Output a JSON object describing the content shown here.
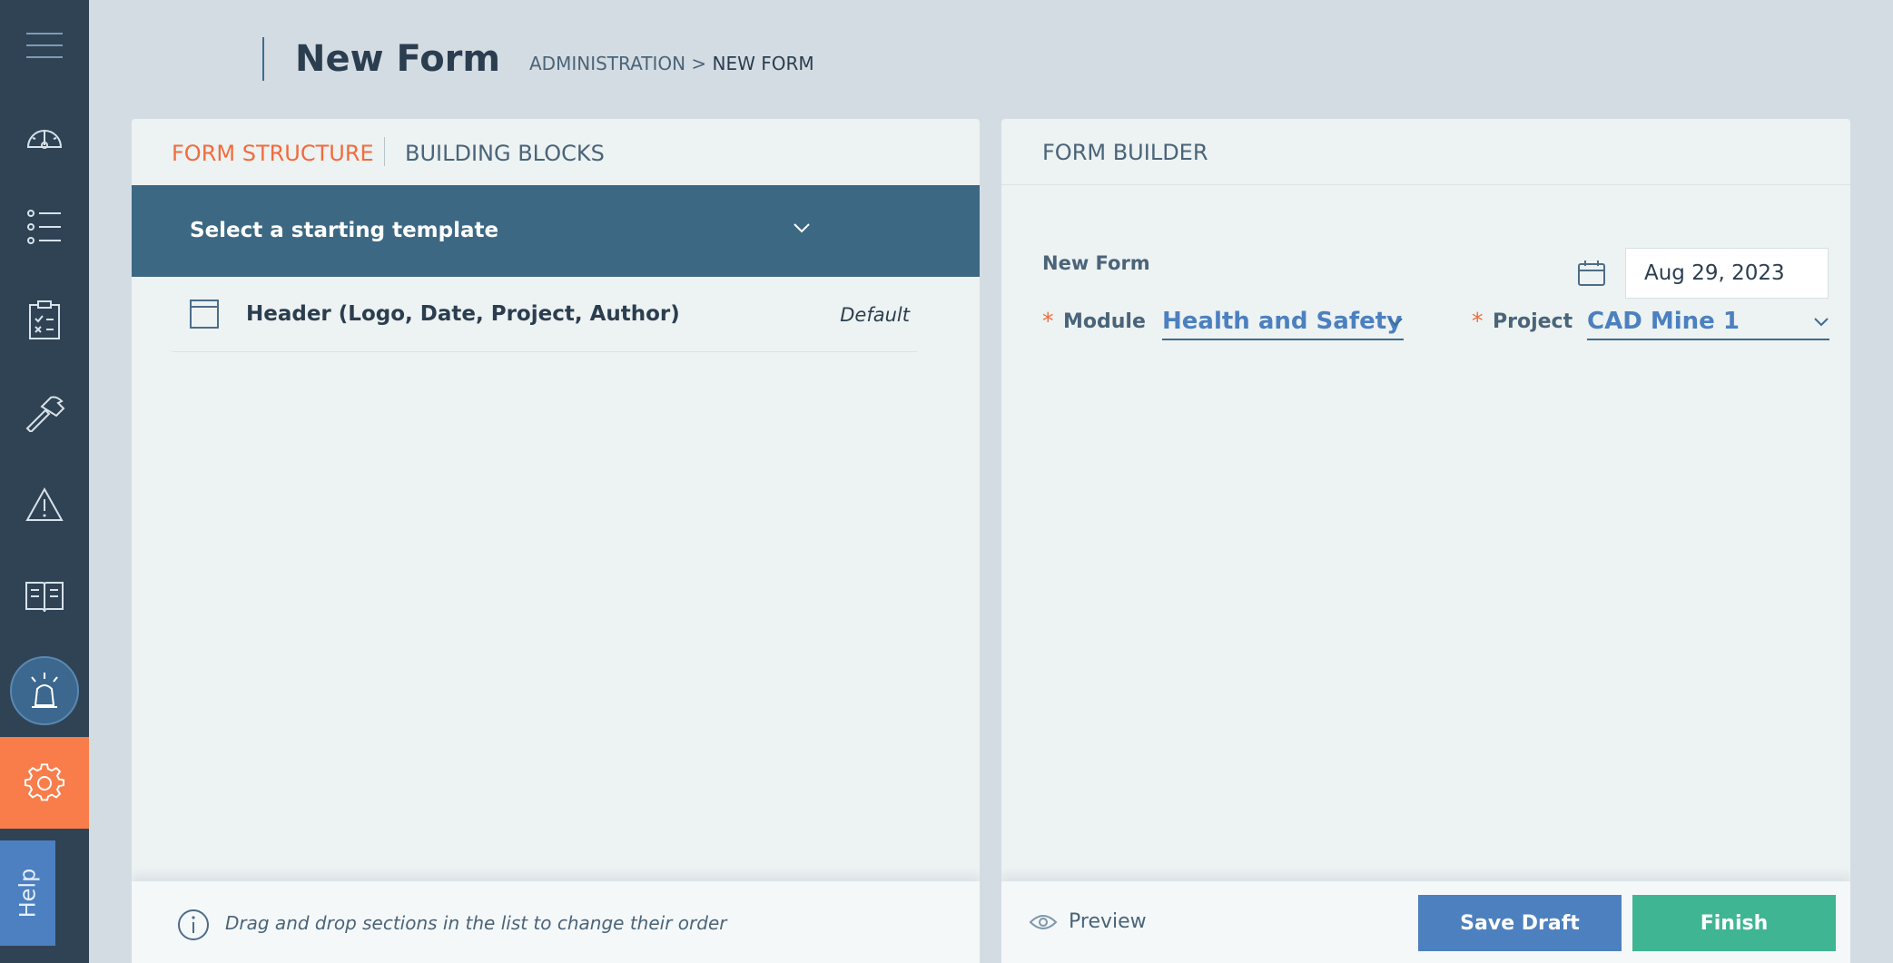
{
  "sidebar": {
    "items": [
      {
        "name": "menu",
        "icon": "hamburger-menu-icon"
      },
      {
        "name": "dashboard",
        "icon": "speedometer-icon"
      },
      {
        "name": "list",
        "icon": "list-icon"
      },
      {
        "name": "checklist",
        "icon": "clipboard-checklist-icon"
      },
      {
        "name": "tools",
        "icon": "hammer-icon"
      },
      {
        "name": "hazards",
        "icon": "warning-triangle-icon"
      },
      {
        "name": "library",
        "icon": "open-book-icon"
      },
      {
        "name": "alerts",
        "icon": "siren-icon"
      },
      {
        "name": "settings",
        "icon": "gear-icon",
        "active": true
      }
    ],
    "help_label": "Help"
  },
  "header": {
    "title": "New Form",
    "breadcrumb": {
      "parent": "ADMINISTRATION",
      "separator": " > ",
      "current": "NEW FORM"
    }
  },
  "left_panel": {
    "tabs": [
      {
        "label": "FORM STRUCTURE",
        "active": true
      },
      {
        "label": "BUILDING BLOCKS",
        "active": false
      }
    ],
    "template_select": {
      "label": "Select a starting template"
    },
    "sections": [
      {
        "label": "Header (Logo, Date, Project, Author)",
        "badge": "Default"
      }
    ],
    "footer_hint": "Drag and drop sections in the list to change their order"
  },
  "right_panel": {
    "title": "FORM BUILDER",
    "form_name": "New Form",
    "date": "Aug 29, 2023",
    "module": {
      "label": "Module",
      "value": "Health and Safety",
      "required_mark": "*"
    },
    "project": {
      "label": "Project",
      "value": "CAD Mine 1",
      "required_mark": "*"
    },
    "preview_label": "Preview",
    "save_draft_label": "Save Draft",
    "finish_label": "Finish"
  },
  "colors": {
    "sidebar": "#2f4355",
    "accent_orange": "#f87d4b",
    "template_bar": "#3c6884",
    "primary_blue": "#4d80bf",
    "finish_green": "#40b593"
  }
}
